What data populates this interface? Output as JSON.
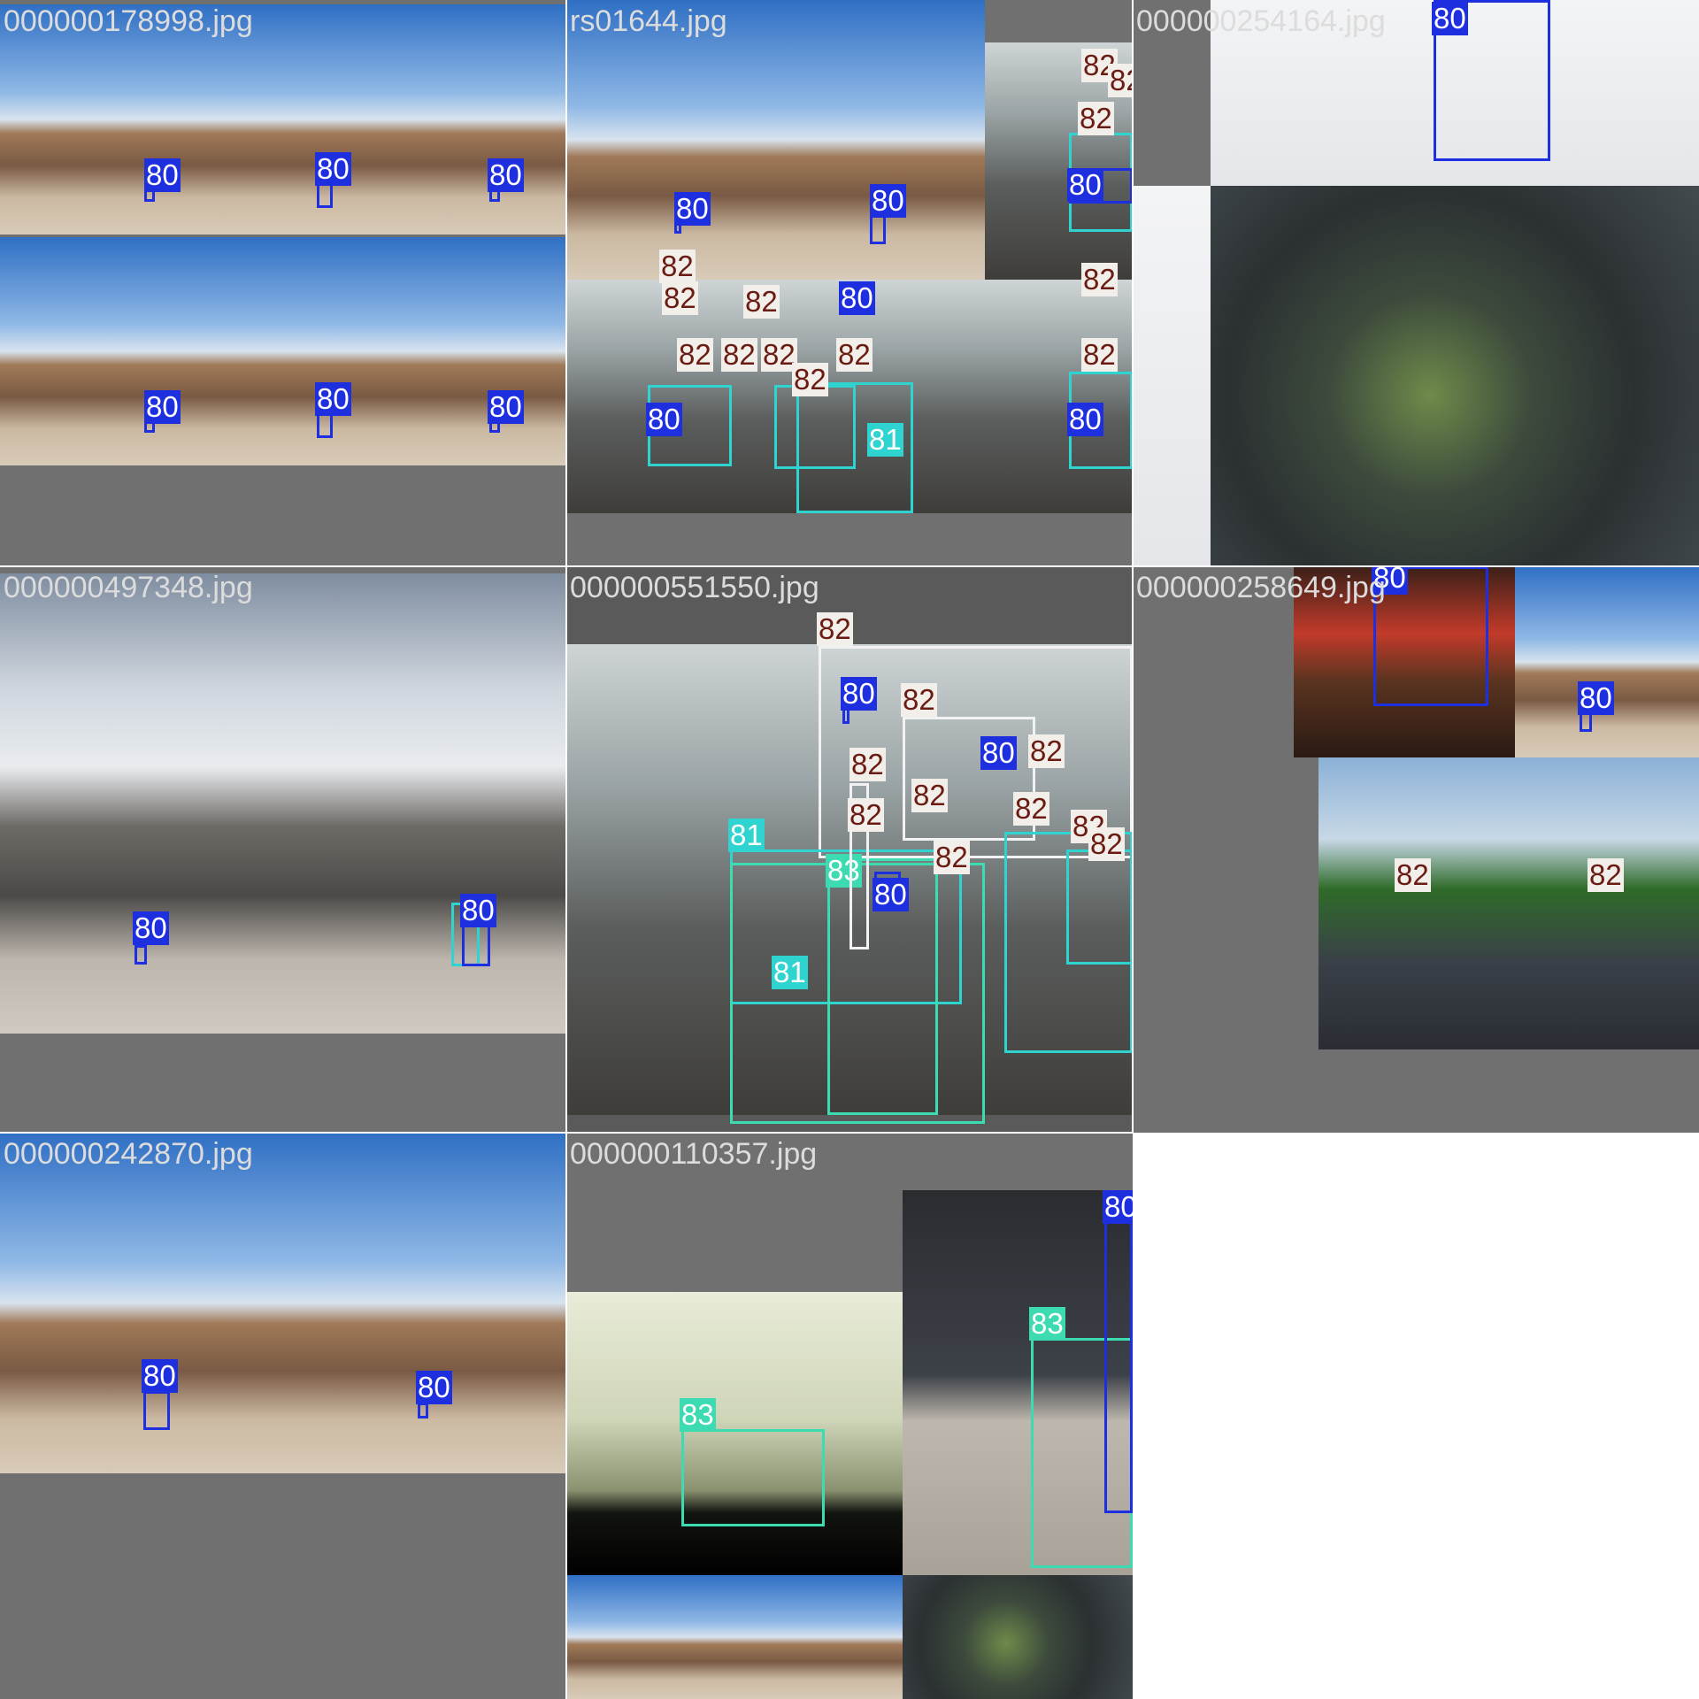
{
  "tiles": [
    {
      "title": "000000178998.jpg"
    },
    {
      "title": "rs01644.jpg"
    },
    {
      "title": "000000254164.jpg"
    },
    {
      "title": "000000497348.jpg"
    },
    {
      "title": "000000551550.jpg"
    },
    {
      "title": "000000258649.jpg"
    },
    {
      "title": "000000242870.jpg"
    },
    {
      "title": "000000110357.jpg"
    }
  ],
  "class_labels": {
    "c80": "80",
    "c81": "81",
    "c82": "82",
    "c83": "83"
  },
  "colors": {
    "class_80": "#1e2fe0",
    "class_81": "#2fd3cf",
    "class_82": "#f2eeea",
    "class_83": "#3ddbb2",
    "tile_bg": "#707070"
  }
}
